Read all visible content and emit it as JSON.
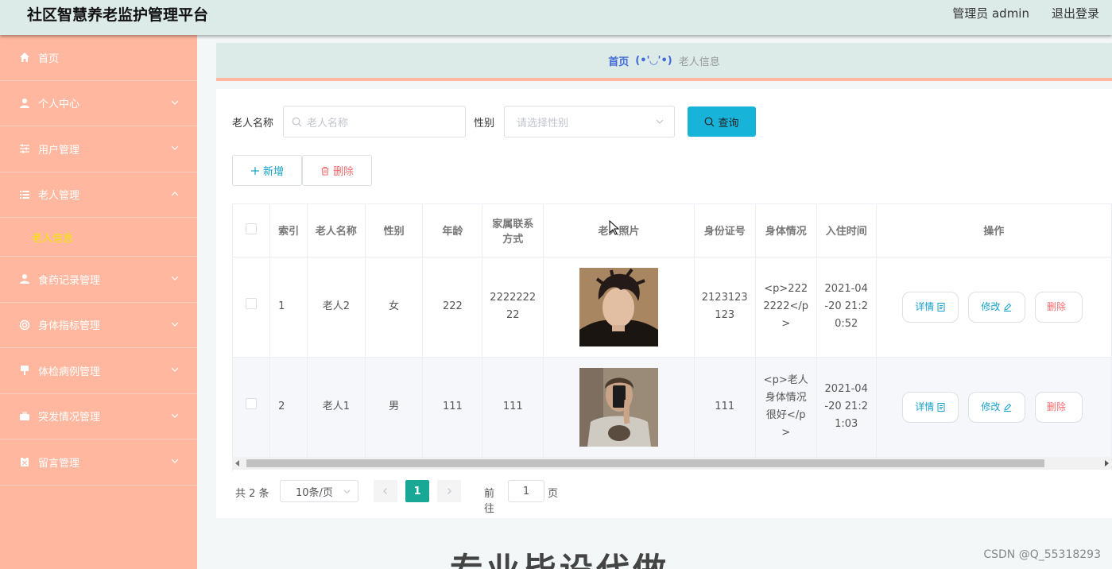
{
  "header": {
    "title": "社区智慧养老监护管理平台",
    "user": "管理员 admin",
    "logout": "退出登录"
  },
  "sidebar": {
    "items": [
      {
        "label": "首页",
        "icon": "home-icon",
        "expandable": false
      },
      {
        "label": "个人中心",
        "icon": "user-icon",
        "expandable": true
      },
      {
        "label": "用户管理",
        "icon": "sliders-icon",
        "expandable": true
      },
      {
        "label": "老人管理",
        "icon": "list-icon",
        "expandable": true,
        "expanded": true,
        "children": [
          "老人信息"
        ]
      },
      {
        "label": "食药记录管理",
        "icon": "user-icon",
        "expandable": true
      },
      {
        "label": "身体指标管理",
        "icon": "lifebuoy-icon",
        "expandable": true
      },
      {
        "label": "体检病例管理",
        "icon": "pin-icon",
        "expandable": true
      },
      {
        "label": "突发情况管理",
        "icon": "briefcase-icon",
        "expandable": true
      },
      {
        "label": "留言管理",
        "icon": "clipboard-icon",
        "expandable": true
      }
    ]
  },
  "breadcrumb": {
    "home": "首页",
    "separator": "(•'◡'•)",
    "current": "老人信息"
  },
  "search": {
    "name_label": "老人名称",
    "name_placeholder": "老人名称",
    "gender_label": "性别",
    "gender_placeholder": "请选择性别",
    "query_label": "查询"
  },
  "actions": {
    "add": "新增",
    "delete": "删除"
  },
  "table": {
    "columns": [
      "索引",
      "老人名称",
      "性别",
      "年龄",
      "家属联系方式",
      "老人照片",
      "身份证号",
      "身体情况",
      "入住时间",
      "操作"
    ],
    "column_header_lines": {
      "contact_line1": "家属联系",
      "contact_line2": "方式"
    },
    "rows": [
      {
        "index": "1",
        "name": "老人2",
        "gender": "女",
        "age": "222",
        "contact_l1": "2222222",
        "contact_l2": "22",
        "id_l1": "2123123",
        "id_l2": "123",
        "health_l1": "<p>222",
        "health_l2": "2222</p",
        "health_l3": ">",
        "time_l1": "2021-04",
        "time_l2": "-20 21:2",
        "time_l3": "0:52"
      },
      {
        "index": "2",
        "name": "老人1",
        "gender": "男",
        "age": "111",
        "contact_l1": "111",
        "contact_l2": "",
        "id_l1": "111",
        "id_l2": "",
        "health_l1": "<p>老人",
        "health_l2": "身体情况",
        "health_l3": "很好</p",
        "health_l4": ">",
        "time_l1": "2021-04",
        "time_l2": "-20 21:2",
        "time_l3": "1:03"
      }
    ],
    "op_detail": "详情",
    "op_edit": "修改",
    "op_delete": "删除"
  },
  "pagination": {
    "total": "共 2 条",
    "page_size": "10条/页",
    "current_page": "1",
    "goto_label": "前往",
    "goto_value": "1",
    "page_label": "页"
  },
  "footer": {
    "big_text": "专业毕设代做",
    "watermark": "CSDN @Q_55318293"
  },
  "colors": {
    "sidebar": "#ffb89f",
    "header": "#dcebe8",
    "accent": "#17b3d9",
    "active_page": "#1aa896",
    "danger": "#f56c6c",
    "submenu_active": "#f3e600"
  }
}
